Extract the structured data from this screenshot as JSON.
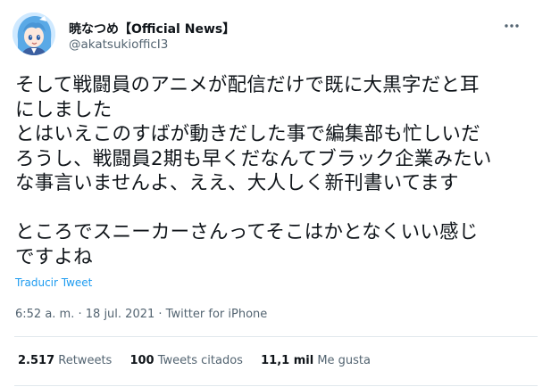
{
  "author": {
    "display_name": "暁なつめ【Official News】",
    "handle": "@akatsukiofficI3"
  },
  "tweet": {
    "text": "そして戦闘員のアニメが配信だけで既に大黒字だと耳\nにしました\nとはいえこのすばが動きだした事で編集部も忙しいだ\nろうし、戦闘員2期も早くだなんてブラック企業みたい\nな事言いませんよ、ええ、大人しく新刊書いてます\n\nところでスニーカーさんってそこはかとなくいい感じ\nですよね",
    "translate_label": "Traducir Tweet"
  },
  "meta": {
    "time": "6:52 a. m.",
    "separator": " · ",
    "date": "18 jul. 2021",
    "source": "Twitter for iPhone"
  },
  "stats": {
    "retweets_count": "2.517",
    "retweets_label": "Retweets",
    "quotes_count": "100",
    "quotes_label": "Tweets citados",
    "likes_count": "11,1 mil",
    "likes_label": "Me gusta"
  },
  "colors": {
    "link": "#1d9bf0",
    "secondary_text": "#536471",
    "divider": "#e1e8ed"
  },
  "icons": {
    "more": "more-options-icon",
    "avatar": "anime-avatar"
  }
}
